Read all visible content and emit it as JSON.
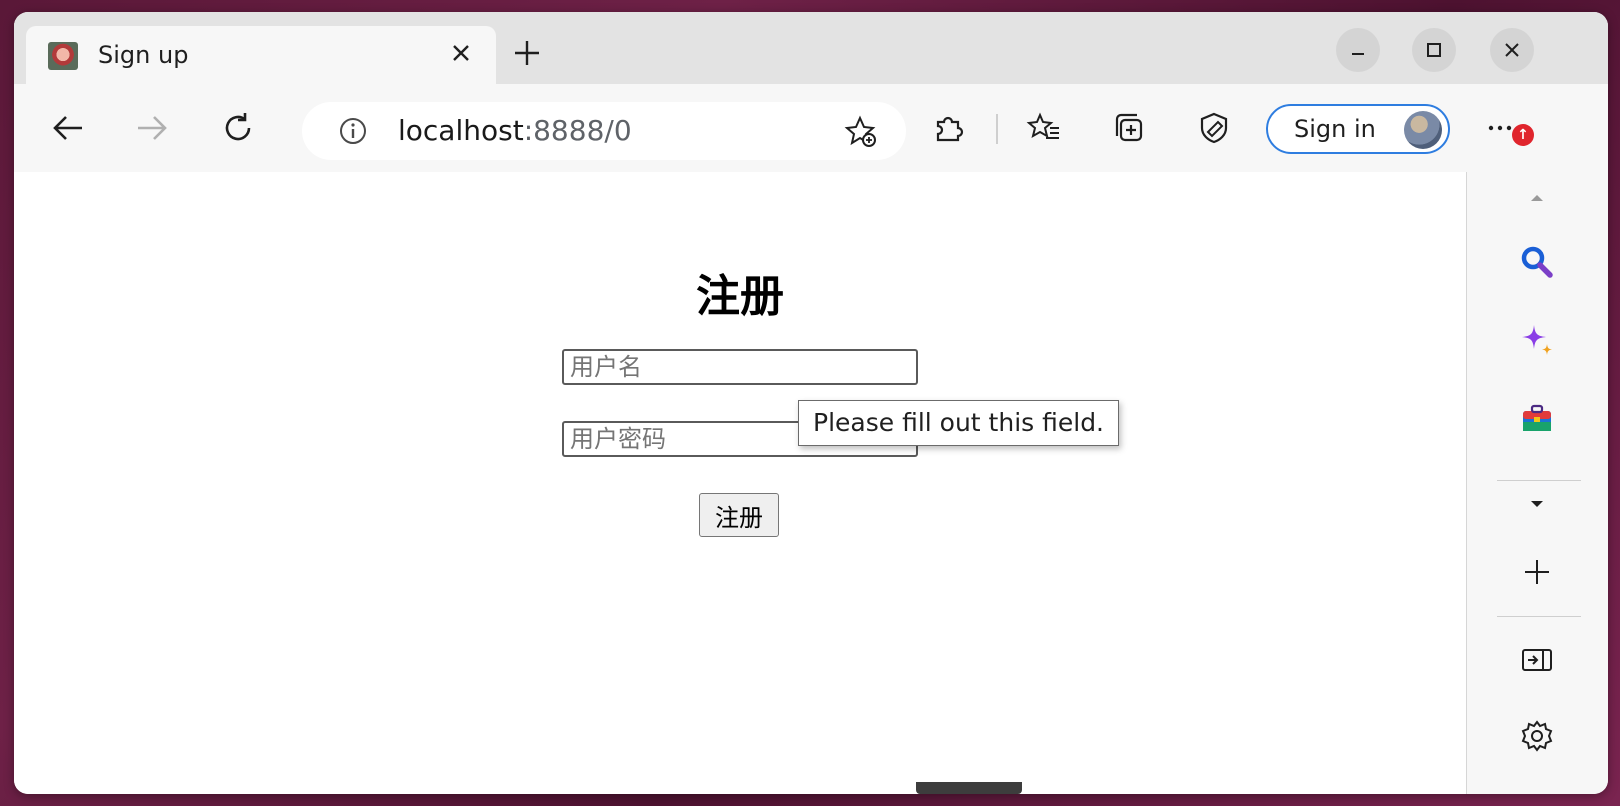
{
  "browser": {
    "tab": {
      "title": "Sign up"
    },
    "address": {
      "host": "localhost",
      "rest": ":8888/0"
    },
    "signin_label": "Sign in",
    "menu_badge": "↑"
  },
  "page": {
    "title": "注册",
    "username_placeholder": "用户名",
    "password_placeholder": "用户密码",
    "submit_label": "注册",
    "validation_tooltip": "Please fill out this field."
  }
}
